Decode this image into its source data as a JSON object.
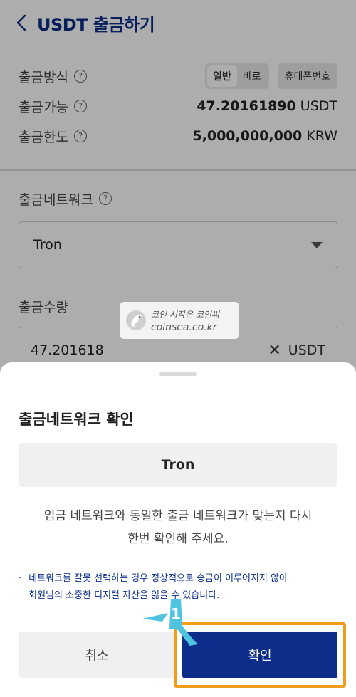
{
  "header": {
    "title": "USDT 출금하기"
  },
  "info": {
    "method_label": "출금방식",
    "method_options": [
      "일반",
      "바로"
    ],
    "method_alt": "휴대폰번호",
    "available_label": "출금가능",
    "available_amount": "47.20161890",
    "available_unit": " USDT",
    "limit_label": "출금한도",
    "limit_amount": "5,000,000,000",
    "limit_unit": " KRW"
  },
  "network": {
    "label": "출금네트워크",
    "selected": "Tron"
  },
  "amount": {
    "label": "출금수량",
    "value": "47.201618",
    "unit": "USDT"
  },
  "watermark": {
    "line1": "코인 시작은 코인씨",
    "line2": "coinsea.co.kr"
  },
  "sheet": {
    "title": "출금네트워크 확인",
    "network": "Tron",
    "message_line1": "입금 네트워크와 동일한 출금 네트워크가 맞는지 다시",
    "message_line2": "한번 확인해 주세요.",
    "notice_line1": "네트워크를 잘못 선택하는 경우 정상적으로 송금이 이루어지지 않아",
    "notice_line2": "회원님의 소중한 디지털 자산을 잃을 수 있습니다.",
    "cancel_label": "취소",
    "confirm_label": "확인"
  },
  "callout": {
    "number": "1"
  },
  "colors": {
    "brand": "#0c2e8a",
    "highlight": "#f29d1a",
    "callout": "#4fc3e0"
  }
}
